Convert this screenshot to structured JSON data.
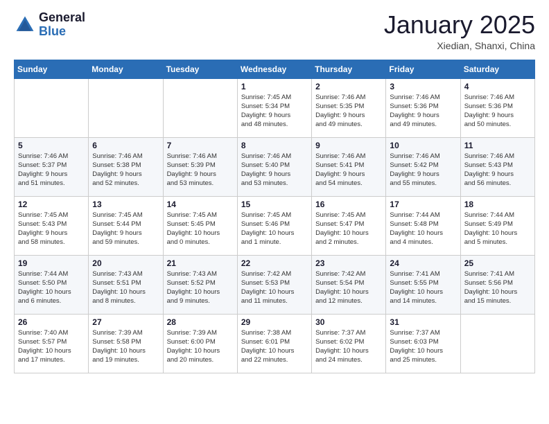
{
  "header": {
    "logo_general": "General",
    "logo_blue": "Blue",
    "month_title": "January 2025",
    "location": "Xiedian, Shanxi, China"
  },
  "days_of_week": [
    "Sunday",
    "Monday",
    "Tuesday",
    "Wednesday",
    "Thursday",
    "Friday",
    "Saturday"
  ],
  "weeks": [
    [
      {
        "day": "",
        "detail": ""
      },
      {
        "day": "",
        "detail": ""
      },
      {
        "day": "",
        "detail": ""
      },
      {
        "day": "1",
        "detail": "Sunrise: 7:45 AM\nSunset: 5:34 PM\nDaylight: 9 hours\nand 48 minutes."
      },
      {
        "day": "2",
        "detail": "Sunrise: 7:46 AM\nSunset: 5:35 PM\nDaylight: 9 hours\nand 49 minutes."
      },
      {
        "day": "3",
        "detail": "Sunrise: 7:46 AM\nSunset: 5:36 PM\nDaylight: 9 hours\nand 49 minutes."
      },
      {
        "day": "4",
        "detail": "Sunrise: 7:46 AM\nSunset: 5:36 PM\nDaylight: 9 hours\nand 50 minutes."
      }
    ],
    [
      {
        "day": "5",
        "detail": "Sunrise: 7:46 AM\nSunset: 5:37 PM\nDaylight: 9 hours\nand 51 minutes."
      },
      {
        "day": "6",
        "detail": "Sunrise: 7:46 AM\nSunset: 5:38 PM\nDaylight: 9 hours\nand 52 minutes."
      },
      {
        "day": "7",
        "detail": "Sunrise: 7:46 AM\nSunset: 5:39 PM\nDaylight: 9 hours\nand 53 minutes."
      },
      {
        "day": "8",
        "detail": "Sunrise: 7:46 AM\nSunset: 5:40 PM\nDaylight: 9 hours\nand 53 minutes."
      },
      {
        "day": "9",
        "detail": "Sunrise: 7:46 AM\nSunset: 5:41 PM\nDaylight: 9 hours\nand 54 minutes."
      },
      {
        "day": "10",
        "detail": "Sunrise: 7:46 AM\nSunset: 5:42 PM\nDaylight: 9 hours\nand 55 minutes."
      },
      {
        "day": "11",
        "detail": "Sunrise: 7:46 AM\nSunset: 5:43 PM\nDaylight: 9 hours\nand 56 minutes."
      }
    ],
    [
      {
        "day": "12",
        "detail": "Sunrise: 7:45 AM\nSunset: 5:43 PM\nDaylight: 9 hours\nand 58 minutes."
      },
      {
        "day": "13",
        "detail": "Sunrise: 7:45 AM\nSunset: 5:44 PM\nDaylight: 9 hours\nand 59 minutes."
      },
      {
        "day": "14",
        "detail": "Sunrise: 7:45 AM\nSunset: 5:45 PM\nDaylight: 10 hours\nand 0 minutes."
      },
      {
        "day": "15",
        "detail": "Sunrise: 7:45 AM\nSunset: 5:46 PM\nDaylight: 10 hours\nand 1 minute."
      },
      {
        "day": "16",
        "detail": "Sunrise: 7:45 AM\nSunset: 5:47 PM\nDaylight: 10 hours\nand 2 minutes."
      },
      {
        "day": "17",
        "detail": "Sunrise: 7:44 AM\nSunset: 5:48 PM\nDaylight: 10 hours\nand 4 minutes."
      },
      {
        "day": "18",
        "detail": "Sunrise: 7:44 AM\nSunset: 5:49 PM\nDaylight: 10 hours\nand 5 minutes."
      }
    ],
    [
      {
        "day": "19",
        "detail": "Sunrise: 7:44 AM\nSunset: 5:50 PM\nDaylight: 10 hours\nand 6 minutes."
      },
      {
        "day": "20",
        "detail": "Sunrise: 7:43 AM\nSunset: 5:51 PM\nDaylight: 10 hours\nand 8 minutes."
      },
      {
        "day": "21",
        "detail": "Sunrise: 7:43 AM\nSunset: 5:52 PM\nDaylight: 10 hours\nand 9 minutes."
      },
      {
        "day": "22",
        "detail": "Sunrise: 7:42 AM\nSunset: 5:53 PM\nDaylight: 10 hours\nand 11 minutes."
      },
      {
        "day": "23",
        "detail": "Sunrise: 7:42 AM\nSunset: 5:54 PM\nDaylight: 10 hours\nand 12 minutes."
      },
      {
        "day": "24",
        "detail": "Sunrise: 7:41 AM\nSunset: 5:55 PM\nDaylight: 10 hours\nand 14 minutes."
      },
      {
        "day": "25",
        "detail": "Sunrise: 7:41 AM\nSunset: 5:56 PM\nDaylight: 10 hours\nand 15 minutes."
      }
    ],
    [
      {
        "day": "26",
        "detail": "Sunrise: 7:40 AM\nSunset: 5:57 PM\nDaylight: 10 hours\nand 17 minutes."
      },
      {
        "day": "27",
        "detail": "Sunrise: 7:39 AM\nSunset: 5:58 PM\nDaylight: 10 hours\nand 19 minutes."
      },
      {
        "day": "28",
        "detail": "Sunrise: 7:39 AM\nSunset: 6:00 PM\nDaylight: 10 hours\nand 20 minutes."
      },
      {
        "day": "29",
        "detail": "Sunrise: 7:38 AM\nSunset: 6:01 PM\nDaylight: 10 hours\nand 22 minutes."
      },
      {
        "day": "30",
        "detail": "Sunrise: 7:37 AM\nSunset: 6:02 PM\nDaylight: 10 hours\nand 24 minutes."
      },
      {
        "day": "31",
        "detail": "Sunrise: 7:37 AM\nSunset: 6:03 PM\nDaylight: 10 hours\nand 25 minutes."
      },
      {
        "day": "",
        "detail": ""
      }
    ]
  ]
}
